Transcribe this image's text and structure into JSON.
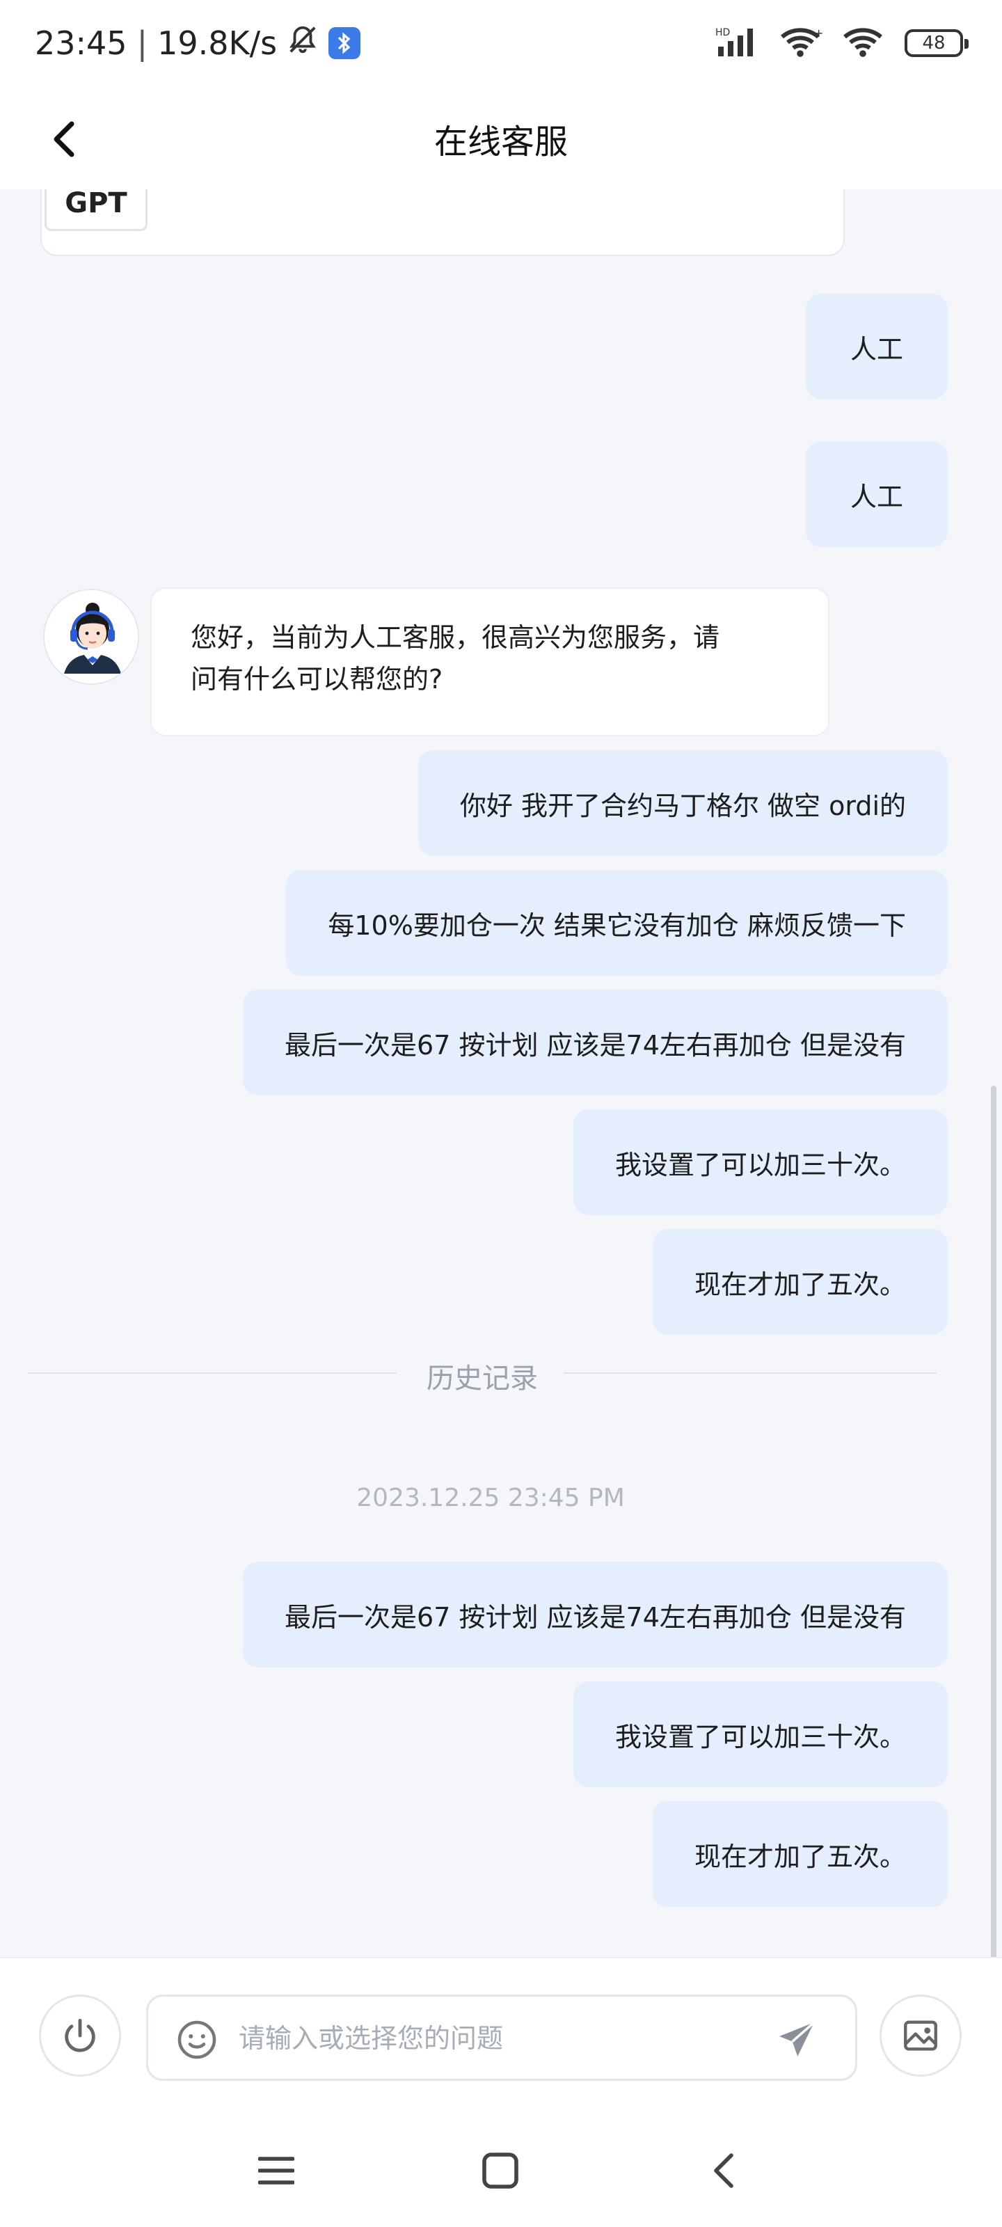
{
  "status_bar": {
    "time": "23:45",
    "network_speed": "19.8K/s",
    "battery": "48",
    "icons": [
      "mute-bell-icon",
      "bluetooth-icon",
      "signal-icon",
      "wifi-icon",
      "wifi-alt-icon",
      "battery-icon"
    ]
  },
  "header": {
    "title": "在线客服",
    "back_icon": "chevron-left-icon"
  },
  "chat": {
    "previous_chip": "GPT",
    "messages_before": [
      {
        "side": "right",
        "text": "人工"
      },
      {
        "side": "right",
        "text": "人工"
      }
    ],
    "agent_message": {
      "line1": "您好，当前为人工客服，很高兴为您服务，请",
      "line2": "问有什么可以帮您的?"
    },
    "messages_after": [
      {
        "side": "right",
        "text": "你好 我开了合约马丁格尔 做空 ordi的"
      },
      {
        "side": "right",
        "text": "每10%要加仓一次 结果它没有加仓 麻烦反馈一下"
      },
      {
        "side": "right",
        "text": "最后一次是67 按计划 应该是74左右再加仓 但是没有"
      },
      {
        "side": "right",
        "text": "我设置了可以加三十次。"
      },
      {
        "side": "right",
        "text": "现在才加了五次。"
      }
    ],
    "history_label": "历史记录",
    "history_timestamp": "2023.12.25 23:45 PM",
    "history_messages": [
      {
        "side": "right",
        "text": "最后一次是67 按计划 应该是74左右再加仓 但是没有"
      },
      {
        "side": "right",
        "text": "我设置了可以加三十次。"
      },
      {
        "side": "right",
        "text": "现在才加了五次。"
      }
    ]
  },
  "input_bar": {
    "placeholder": "请输入或选择您的问题",
    "value": "",
    "icons": [
      "power-icon",
      "emoji-icon",
      "send-icon",
      "image-icon"
    ]
  },
  "nav_bar": {
    "icons": [
      "menu-icon",
      "home-square-icon",
      "back-chevron-icon"
    ]
  },
  "colors": {
    "user_bubble": "#e5eefd",
    "chat_background": "#f4f6fa",
    "agent_bubble": "#ffffff",
    "muted_text": "#9aa1ab"
  }
}
